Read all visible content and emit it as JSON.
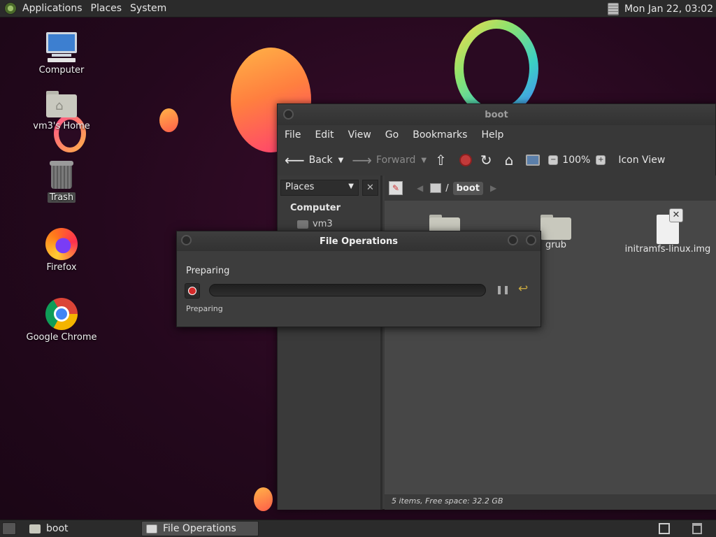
{
  "top_panel": {
    "menus": [
      "Applications",
      "Places",
      "System"
    ],
    "clock": "Mon Jan 22, 03:02"
  },
  "desktop": {
    "icons": [
      {
        "label": "Computer",
        "icon": "computer-icon"
      },
      {
        "label": "vm3's Home",
        "icon": "home-folder-icon"
      },
      {
        "label": "Trash",
        "icon": "trash-icon"
      },
      {
        "label": "Firefox",
        "icon": "firefox-icon"
      },
      {
        "label": "Google Chrome",
        "icon": "chrome-icon"
      }
    ]
  },
  "file_manager": {
    "title": "boot",
    "menu": [
      "File",
      "Edit",
      "View",
      "Go",
      "Bookmarks",
      "Help"
    ],
    "toolbar": {
      "back": "Back",
      "forward": "Forward",
      "zoom": "100%",
      "view_mode": "Icon View"
    },
    "sidebar": {
      "selector": "Places",
      "heading": "Computer",
      "items": [
        "vm3"
      ]
    },
    "path": {
      "current": "boot"
    },
    "files": [
      {
        "name": "",
        "type": "folder"
      },
      {
        "name": "grub",
        "type": "folder"
      },
      {
        "name": "initramfs-linux.img",
        "type": "file"
      }
    ],
    "status": "5 items, Free space: 32.2 GB"
  },
  "file_operations": {
    "title": "File Operations",
    "heading": "Preparing",
    "status": "Preparing",
    "progress": 0
  },
  "taskbar": {
    "tasks": [
      {
        "label": "boot",
        "active": false
      },
      {
        "label": "File Operations",
        "active": true
      }
    ]
  },
  "colors": {
    "accent": "#5a7fb5",
    "stop_red": "#d42a2a",
    "panel_bg": "#2b2b2b"
  }
}
